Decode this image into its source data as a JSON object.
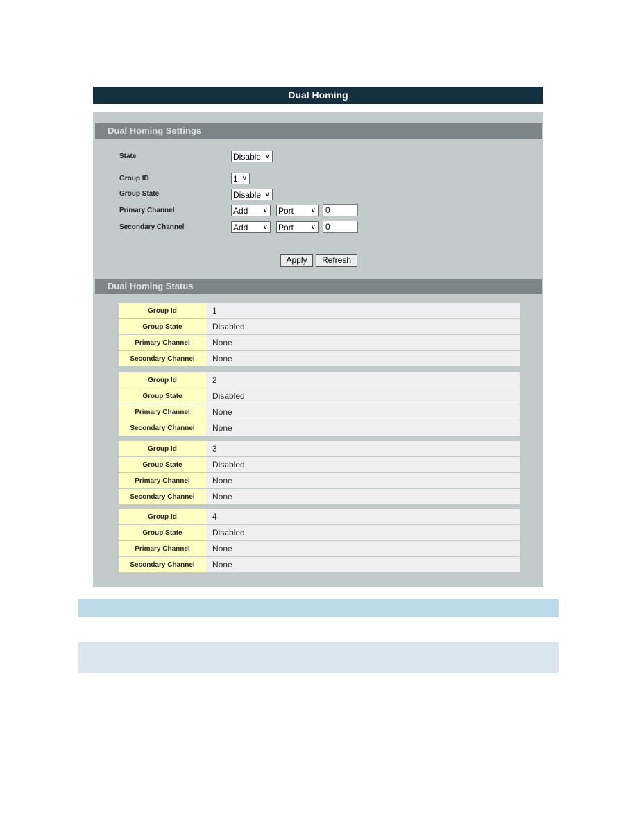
{
  "title": "Dual Homing",
  "settings": {
    "header": "Dual Homing Settings",
    "state_label": "State",
    "state_value": "Disable",
    "group_id_label": "Group ID",
    "group_id_value": "1",
    "group_state_label": "Group State",
    "group_state_value": "Disable",
    "primary_label": "Primary Channel",
    "primary_action": "Add",
    "primary_type": "Port",
    "primary_value": "0",
    "secondary_label": "Secondary Channel",
    "secondary_action": "Add",
    "secondary_type": "Port",
    "secondary_value": "0",
    "apply": "Apply",
    "refresh": "Refresh"
  },
  "status": {
    "header": "Dual Homing Status",
    "labels": [
      "Group Id",
      "Group State",
      "Primary Channel",
      "Secondary Channel"
    ],
    "groups": [
      [
        "1",
        "Disabled",
        "None",
        "None"
      ],
      [
        "2",
        "Disabled",
        "None",
        "None"
      ],
      [
        "3",
        "Disabled",
        "None",
        "None"
      ],
      [
        "4",
        "Disabled",
        "None",
        "None"
      ]
    ]
  },
  "colors": {
    "title_bar": "#15303f",
    "panel": "#c3cbca",
    "section_header": "#7c8686",
    "label_cell": "#ffffc4"
  }
}
